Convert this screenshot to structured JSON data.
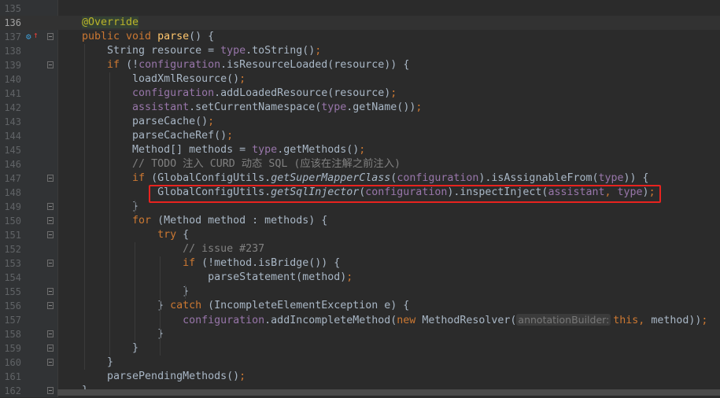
{
  "editor": {
    "current_line": 136,
    "highlight_line": 148,
    "highlight_color": "#e8231f",
    "gutter_icons": {
      "line": 137,
      "icons": [
        "overriding-method-icon",
        "implements-up-arrow-icon"
      ]
    },
    "fold_open": [
      137,
      139,
      147,
      150,
      151,
      153,
      156
    ],
    "fold_close": [
      149,
      155,
      158,
      159,
      160,
      162
    ],
    "lines": [
      {
        "n": "135",
        "t": []
      },
      {
        "n": "136",
        "t": [
          [
            "a",
            "@Override"
          ]
        ]
      },
      {
        "n": "137",
        "t": [
          [
            "k",
            "public void "
          ],
          [
            "m",
            "parse"
          ],
          [
            "t",
            "() {"
          ]
        ]
      },
      {
        "n": "138",
        "t": [
          [
            "t",
            "    String resource = "
          ],
          [
            "f",
            "type"
          ],
          [
            "t",
            ".toString()"
          ],
          [
            "k",
            ";"
          ]
        ]
      },
      {
        "n": "139",
        "t": [
          [
            "t",
            "    "
          ],
          [
            "k",
            "if "
          ],
          [
            "t",
            "(!"
          ],
          [
            "f",
            "configuration"
          ],
          [
            "t",
            ".isResourceLoaded(resource)) {"
          ]
        ]
      },
      {
        "n": "140",
        "t": [
          [
            "t",
            "        loadXmlResource()"
          ],
          [
            "k",
            ";"
          ]
        ]
      },
      {
        "n": "141",
        "t": [
          [
            "t",
            "        "
          ],
          [
            "f",
            "configuration"
          ],
          [
            "t",
            ".addLoadedResource(resource)"
          ],
          [
            "k",
            ";"
          ]
        ]
      },
      {
        "n": "142",
        "t": [
          [
            "t",
            "        "
          ],
          [
            "f",
            "assistant"
          ],
          [
            "t",
            ".setCurrentNamespace("
          ],
          [
            "f",
            "type"
          ],
          [
            "t",
            ".getName())"
          ],
          [
            "k",
            ";"
          ]
        ]
      },
      {
        "n": "143",
        "t": [
          [
            "t",
            "        parseCache()"
          ],
          [
            "k",
            ";"
          ]
        ]
      },
      {
        "n": "144",
        "t": [
          [
            "t",
            "        parseCacheRef()"
          ],
          [
            "k",
            ";"
          ]
        ]
      },
      {
        "n": "145",
        "t": [
          [
            "t",
            "        Method[] methods = "
          ],
          [
            "f",
            "type"
          ],
          [
            "t",
            ".getMethods()"
          ],
          [
            "k",
            ";"
          ]
        ]
      },
      {
        "n": "146",
        "t": [
          [
            "t",
            "        "
          ],
          [
            "c",
            "// TODO 注入 CURD 动态 SQL (应该在注解之前注入)"
          ]
        ]
      },
      {
        "n": "147",
        "t": [
          [
            "t",
            "        "
          ],
          [
            "k",
            "if "
          ],
          [
            "t",
            "(GlobalConfigUtils."
          ],
          [
            "i",
            "getSuperMapperClass"
          ],
          [
            "t",
            "("
          ],
          [
            "f",
            "configuration"
          ],
          [
            "t",
            ").isAssignableFrom("
          ],
          [
            "f",
            "type"
          ],
          [
            "t",
            ")) {"
          ]
        ]
      },
      {
        "n": "148",
        "t": [
          [
            "t",
            "            GlobalConfigUtils."
          ],
          [
            "i",
            "getSqlInjector"
          ],
          [
            "t",
            "("
          ],
          [
            "f",
            "configuration"
          ],
          [
            "t",
            ").inspectInject("
          ],
          [
            "f",
            "assistant"
          ],
          [
            "k",
            ", "
          ],
          [
            "f",
            "type"
          ],
          [
            "t",
            ")"
          ],
          [
            "k",
            ";"
          ]
        ]
      },
      {
        "n": "149",
        "t": [
          [
            "t",
            "        }"
          ]
        ]
      },
      {
        "n": "150",
        "t": [
          [
            "t",
            "        "
          ],
          [
            "k",
            "for "
          ],
          [
            "t",
            "(Method method : methods) {"
          ]
        ]
      },
      {
        "n": "151",
        "t": [
          [
            "t",
            "            "
          ],
          [
            "k",
            "try "
          ],
          [
            "t",
            "{"
          ]
        ]
      },
      {
        "n": "152",
        "t": [
          [
            "t",
            "                "
          ],
          [
            "c",
            "// issue #237"
          ]
        ]
      },
      {
        "n": "153",
        "t": [
          [
            "t",
            "                "
          ],
          [
            "k",
            "if "
          ],
          [
            "t",
            "(!method.isBridge()) {"
          ]
        ]
      },
      {
        "n": "154",
        "t": [
          [
            "t",
            "                    parseStatement(method)"
          ],
          [
            "k",
            ";"
          ]
        ]
      },
      {
        "n": "155",
        "t": [
          [
            "t",
            "                }"
          ]
        ]
      },
      {
        "n": "156",
        "t": [
          [
            "t",
            "            } "
          ],
          [
            "k",
            "catch "
          ],
          [
            "t",
            "(IncompleteElementException e) {"
          ]
        ]
      },
      {
        "n": "157",
        "t": [
          [
            "t",
            "                "
          ],
          [
            "f",
            "configuration"
          ],
          [
            "t",
            ".addIncompleteMethod("
          ],
          [
            "k",
            "new "
          ],
          [
            "t",
            "MethodResolver("
          ],
          [
            "h",
            "annotationBuilder:"
          ],
          [
            "k",
            "this, "
          ],
          [
            "t",
            "method))"
          ],
          [
            "k",
            ";"
          ]
        ]
      },
      {
        "n": "158",
        "t": [
          [
            "t",
            "            }"
          ]
        ]
      },
      {
        "n": "159",
        "t": [
          [
            "t",
            "        }"
          ]
        ]
      },
      {
        "n": "160",
        "t": [
          [
            "t",
            "    }"
          ]
        ]
      },
      {
        "n": "161",
        "t": [
          [
            "t",
            "    parsePendingMethods()"
          ],
          [
            "k",
            ";"
          ]
        ]
      },
      {
        "n": "162",
        "t": [
          [
            "t",
            "}"
          ]
        ]
      }
    ]
  }
}
